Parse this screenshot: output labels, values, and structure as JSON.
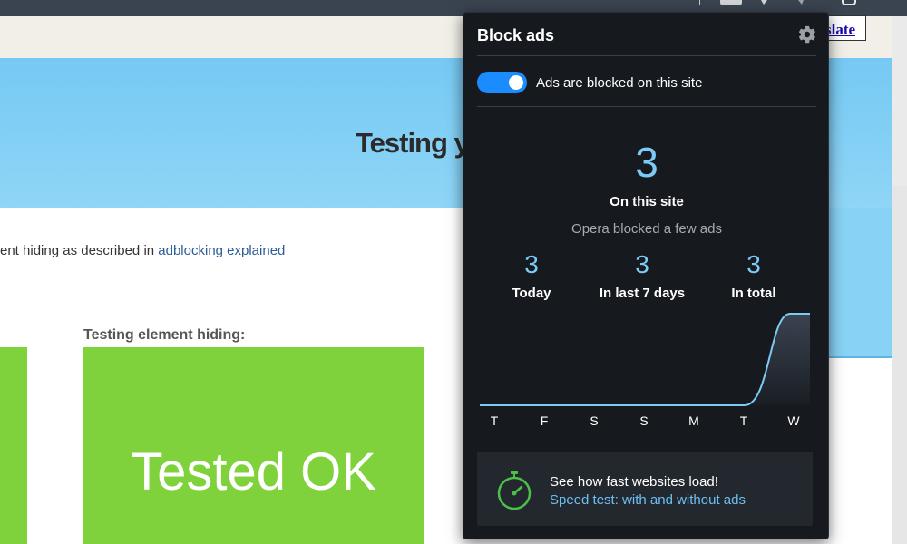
{
  "browser": {
    "translate_label": "slate"
  },
  "page": {
    "hero_title": "Testing yo",
    "body_prefix": "ent hiding as described in ",
    "body_link": "adblocking explained",
    "element_hiding_label": "Testing element hiding:",
    "tested_ok": "Tested OK"
  },
  "popup": {
    "title": "Block ads",
    "toggle_label": "Ads are blocked on this site",
    "toggle_on": true,
    "on_site_count": "3",
    "on_site_label": "On this site",
    "subtitle": "Opera blocked a few ads",
    "stats": [
      {
        "value": "3",
        "label": "Today"
      },
      {
        "value": "3",
        "label": "In last 7 days"
      },
      {
        "value": "3",
        "label": "In total"
      }
    ],
    "days": [
      "T",
      "F",
      "S",
      "S",
      "M",
      "T",
      "W"
    ],
    "card_title": "See how fast websites load!",
    "card_link": "Speed test: with and without ads",
    "accent_color": "#7ccaf6",
    "toggle_color": "#1a8cff",
    "icons": [
      "gear-icon",
      "stopwatch-icon"
    ]
  },
  "chart_data": {
    "type": "area",
    "categories": [
      "T",
      "F",
      "S",
      "S",
      "M",
      "T",
      "W"
    ],
    "values": [
      0,
      0,
      0,
      0,
      0,
      0,
      3
    ],
    "grid": false
  }
}
